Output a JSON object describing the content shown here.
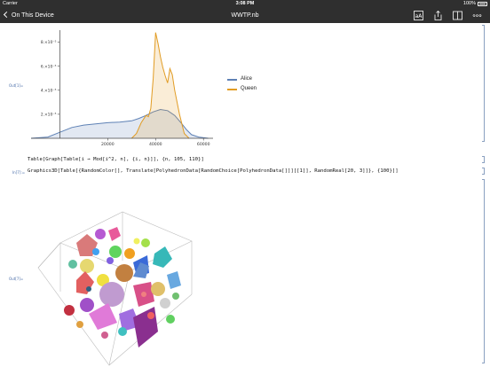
{
  "status_bar": {
    "carrier": "Carrier",
    "time": "3:08 PM",
    "battery": "100%"
  },
  "nav": {
    "back_label": "On This Device",
    "title": "WWTP.nb",
    "icons": [
      "font-size-icon",
      "share-icon",
      "sidebar-icon",
      "more-icon"
    ]
  },
  "cells": {
    "out1_label": "Out[1]=",
    "code1": "Table[Graph[Table[i → Mod[i^2, n], {i, n}]], {n, 105, 110}]",
    "in7_label": "In[7]:=",
    "code7": "Graphics3D[Table[{RandomColor[], Translate[PolyhedronData[RandomChoice[PolyhedronData[]]][[1]], RandomReal[20, 3]]}, {100}]]",
    "out7_label": "Out[7]="
  },
  "colors": {
    "alice": "#5e81b5",
    "queen": "#e19c24",
    "bar": "#2f2f2f"
  },
  "chart_data": {
    "type": "area",
    "title": "",
    "xlabel": "",
    "ylabel": "",
    "xlim": [
      -12000,
      64000
    ],
    "ylim": [
      0,
      9e-05
    ],
    "xticks": [
      20000,
      40000,
      60000
    ],
    "xtick_labels": [
      "20000",
      "40000",
      "60000"
    ],
    "yticks": [
      2e-05,
      4e-05,
      6e-05,
      8e-05
    ],
    "ytick_labels": [
      "2.×10⁻⁵",
      "4.×10⁻⁵",
      "6.×10⁻⁵",
      "8.×10⁻⁵"
    ],
    "legend_position": "right",
    "series": [
      {
        "name": "Alice",
        "x": [
          -12000,
          -5000,
          0,
          5000,
          10000,
          15000,
          20000,
          25000,
          30000,
          33000,
          36000,
          39000,
          42000,
          45000,
          48000,
          51000,
          53000,
          55000,
          58000,
          62000
        ],
        "y": [
          0.0,
          1e-06,
          5e-06,
          9e-06,
          1.1e-05,
          1.2e-05,
          1.3e-05,
          1.35e-05,
          1.45e-05,
          1.65e-05,
          1.9e-05,
          2.2e-05,
          2.4e-05,
          2.3e-05,
          1.9e-05,
          1.2e-05,
          7e-06,
          3e-06,
          1e-06,
          0.0
        ]
      },
      {
        "name": "Queen",
        "x": [
          30000,
          32000,
          34000,
          36000,
          37000,
          38000,
          39000,
          40000,
          41000,
          42000,
          43000,
          44000,
          45000,
          46000,
          47000,
          48000,
          50000,
          52000,
          54000
        ],
        "y": [
          0.0,
          4e-06,
          1.3e-05,
          1.9e-05,
          1.8e-05,
          2.5e-05,
          5e-05,
          8.8e-05,
          7.9e-05,
          6.8e-05,
          5.9e-05,
          5.2e-05,
          4.6e-05,
          5.8e-05,
          5.3e-05,
          4e-05,
          2e-05,
          4e-06,
          0.0
        ]
      }
    ]
  }
}
